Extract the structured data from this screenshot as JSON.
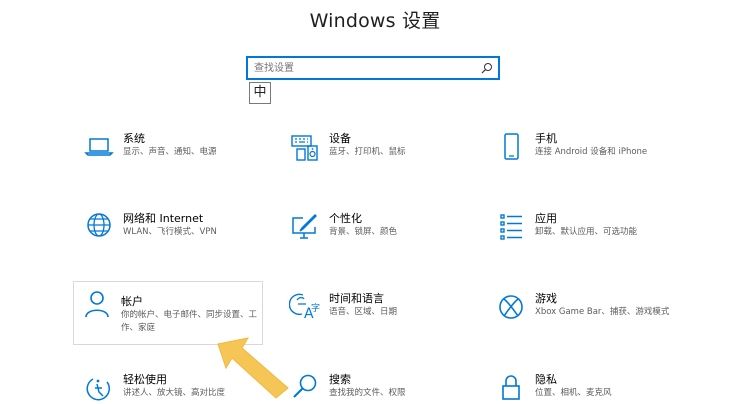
{
  "window": {
    "title": "Windows 设置"
  },
  "search": {
    "placeholder": "查找设置",
    "icon": "search-icon"
  },
  "ime": {
    "label": "中"
  },
  "accent": "#0078d7",
  "categories": [
    {
      "title": "系统",
      "desc": "显示、声音、通知、电源",
      "icon": "laptop-icon"
    },
    {
      "title": "设备",
      "desc": "蓝牙、打印机、鼠标",
      "icon": "keyboard-speaker-icon"
    },
    {
      "title": "手机",
      "desc": "连接 Android 设备和 iPhone",
      "icon": "phone-icon"
    },
    {
      "title": "网络和 Internet",
      "desc": "WLAN、飞行模式、VPN",
      "icon": "globe-icon"
    },
    {
      "title": "个性化",
      "desc": "背景、锁屏、颜色",
      "icon": "paint-screen-icon"
    },
    {
      "title": "应用",
      "desc": "卸载、默认应用、可选功能",
      "icon": "apps-list-icon"
    },
    {
      "title": "帐户",
      "desc": "你的帐户、电子邮件、同步设置、工作、家庭",
      "icon": "person-icon"
    },
    {
      "title": "时间和语言",
      "desc": "语音、区域、日期",
      "icon": "time-language-icon"
    },
    {
      "title": "游戏",
      "desc": "Xbox Game Bar、捕获、游戏模式",
      "icon": "xbox-icon"
    },
    {
      "title": "轻松使用",
      "desc": "讲述人、放大镜、高对比度",
      "icon": "ease-of-access-icon"
    },
    {
      "title": "搜索",
      "desc": "查找我的文件、权限",
      "icon": "magnifier-icon"
    },
    {
      "title": "隐私",
      "desc": "位置、相机、麦克风",
      "icon": "lock-icon"
    }
  ],
  "annotation": {
    "arrow_color": "#f5c556"
  }
}
